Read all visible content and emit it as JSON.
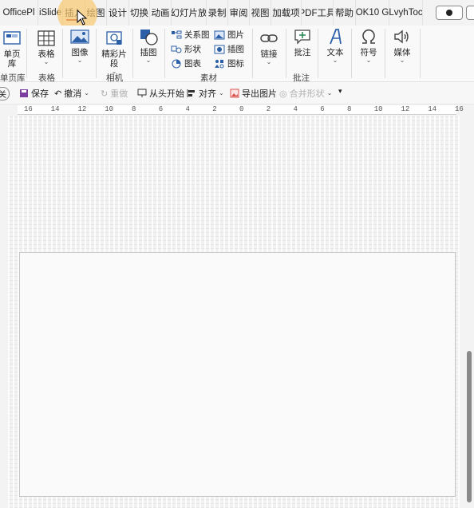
{
  "tabs": [
    "OfficePl",
    "iSlide",
    "插入",
    "绘图",
    "设计",
    "切换",
    "动画",
    "幻灯片放",
    "录制",
    "审阅",
    "视图",
    "加载项",
    "PDF工具",
    "帮助",
    "OK10 G",
    "LvyhToc"
  ],
  "ribbon": {
    "new_slide": "单页库",
    "table": "表格",
    "image": "图像",
    "photo_album": "精彩片段",
    "screenshot": "插图",
    "smartart": "关系图",
    "shapes": "形状",
    "chart": "图表",
    "pictures": "图片",
    "illustration": "插图",
    "icons": "图标",
    "link": "链接",
    "comment": "批注",
    "text": "文本",
    "symbol": "符号",
    "media": "媒体",
    "groups": {
      "slides": "单页库",
      "tables": "表格",
      "camera": "相机",
      "materials": "素材",
      "comments": "批注"
    }
  },
  "qat": {
    "close": "关",
    "save": "保存",
    "undo": "撤消",
    "redo": "重做",
    "from_start": "从头开始",
    "align": "对齐",
    "export_image": "导出图片",
    "merge_shapes": "合并形状"
  },
  "ruler": {
    "labels": [
      "16",
      "14",
      "12",
      "10",
      "8",
      "6",
      "4",
      "2",
      "0",
      "2",
      "4",
      "6",
      "8",
      "10",
      "12",
      "14",
      "16"
    ]
  },
  "colors": {
    "accent": "#c0392b",
    "highlight": "#f7c86e",
    "icon_blue": "#2b5fa8"
  }
}
